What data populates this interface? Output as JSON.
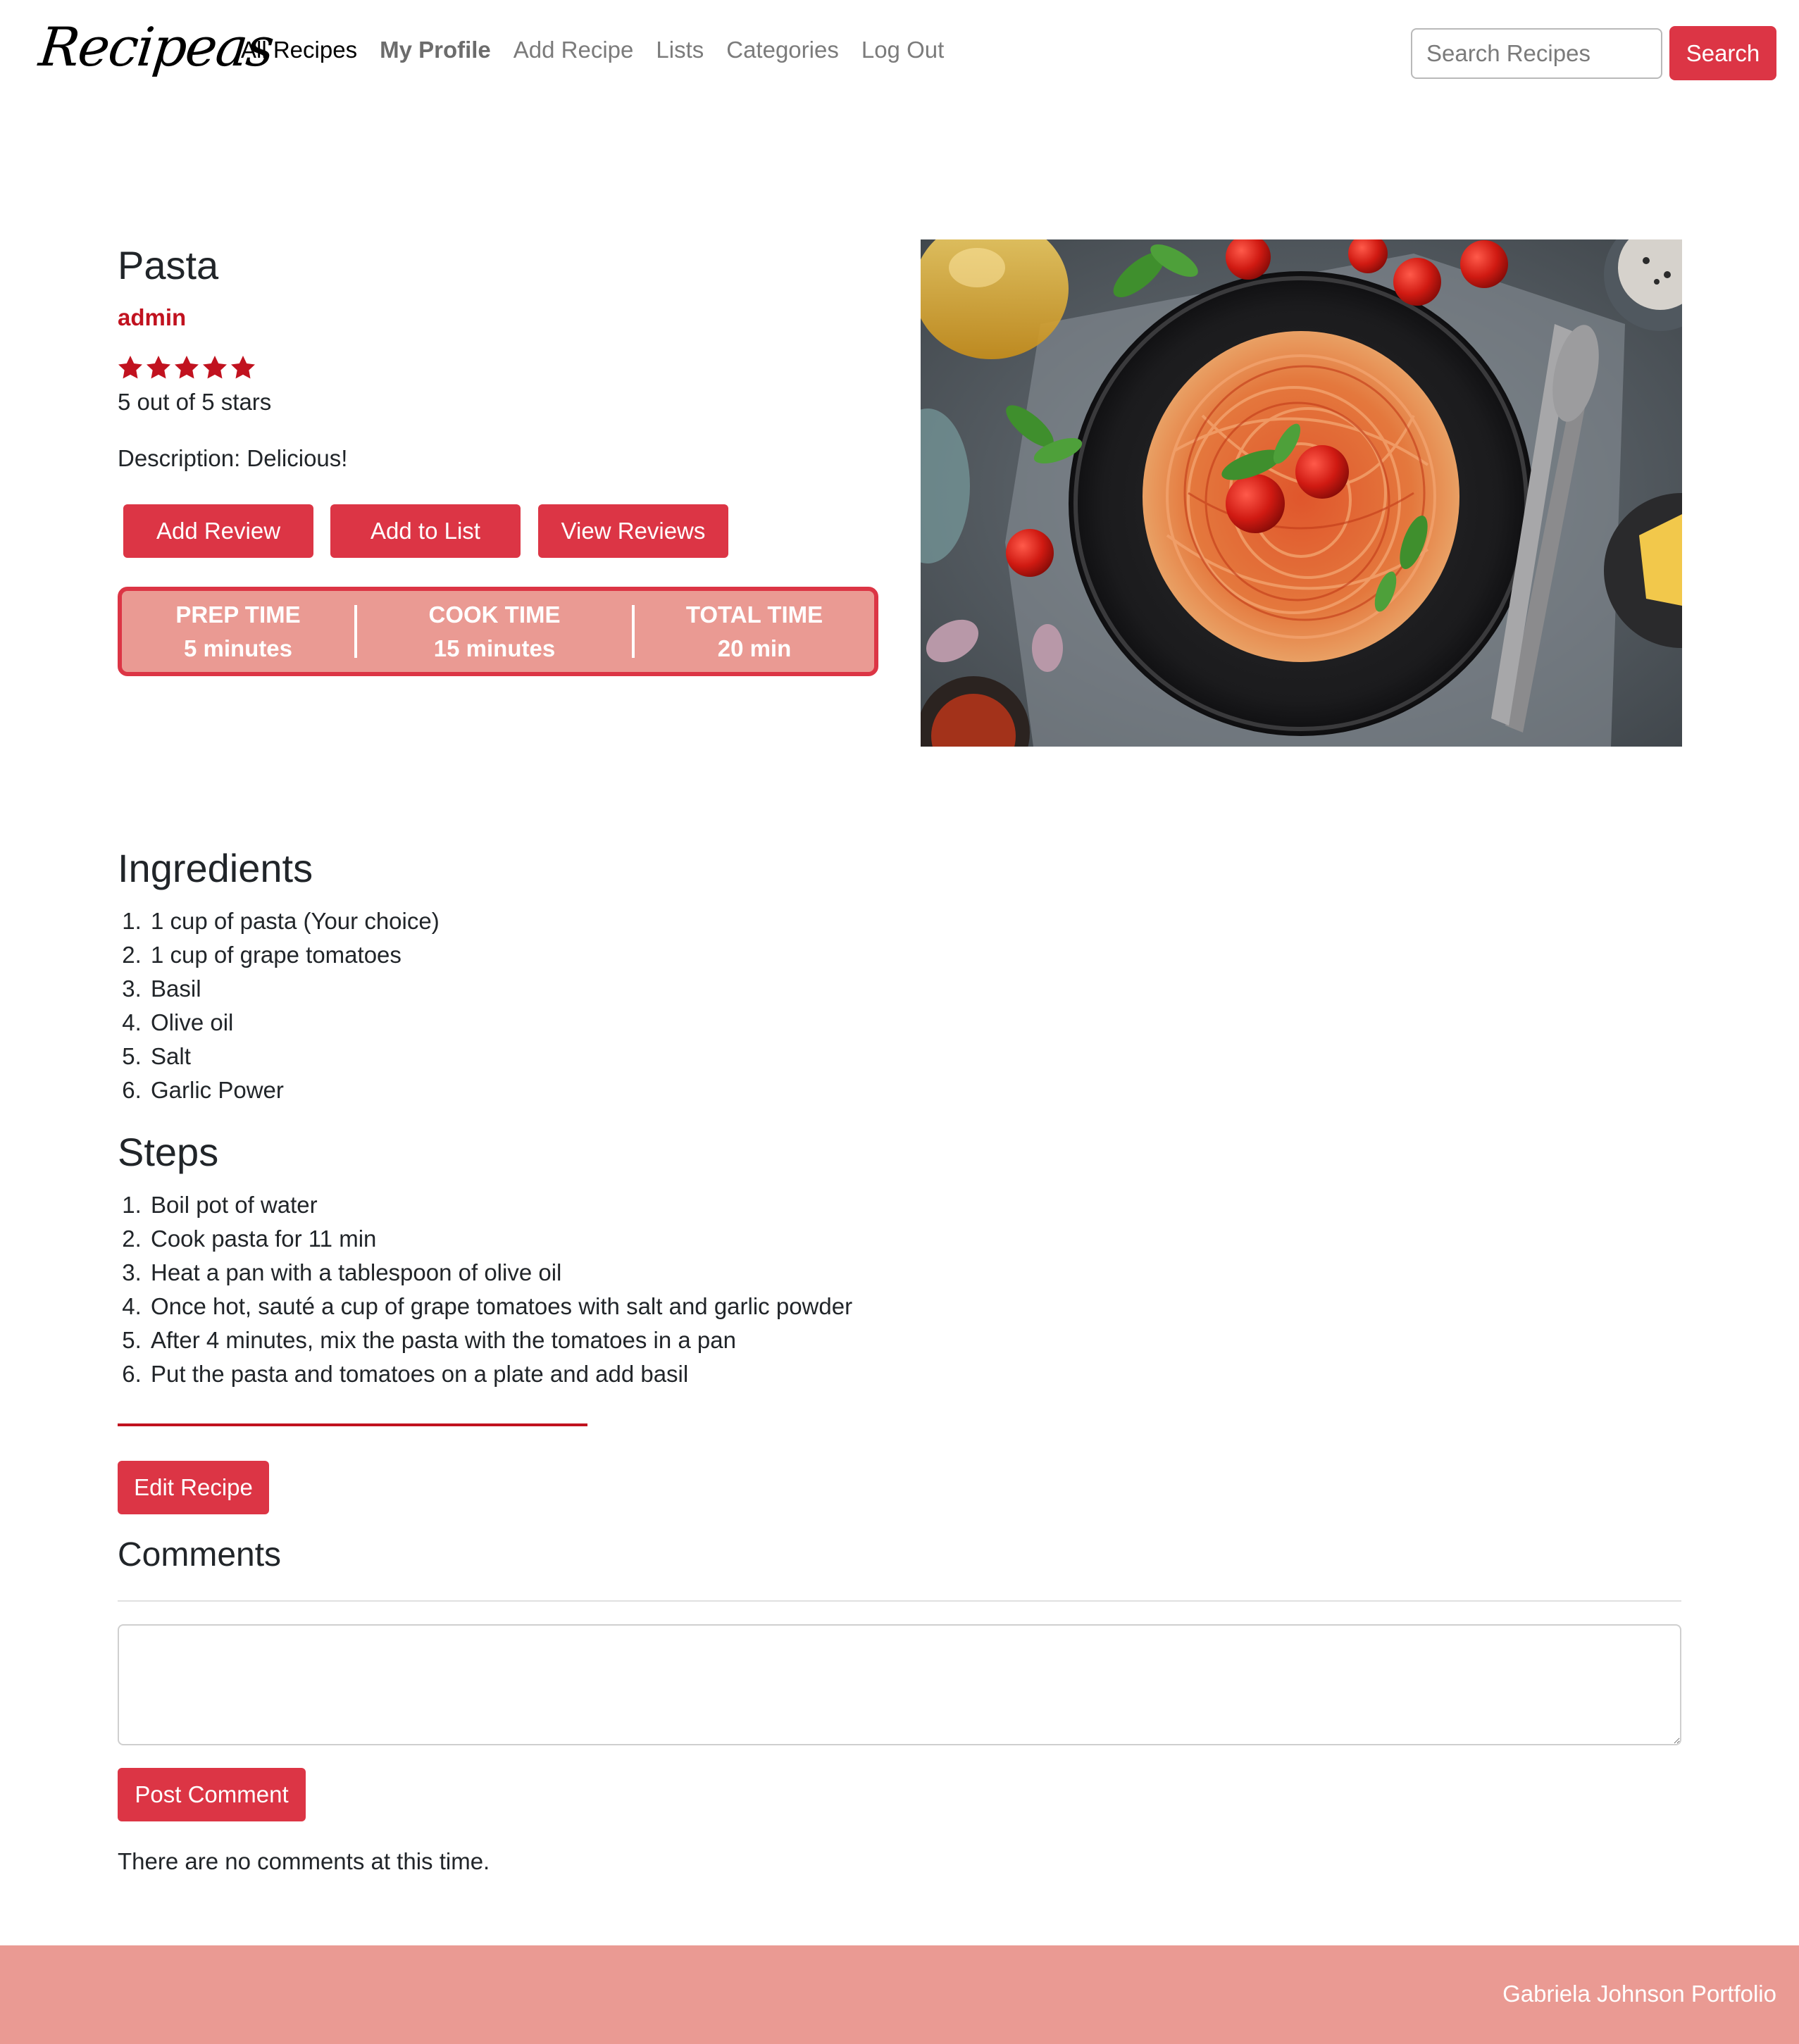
{
  "nav": {
    "logo": "Recipeas",
    "links": [
      "All Recipes",
      "My Profile",
      "Add Recipe",
      "Lists",
      "Categories",
      "Log Out"
    ],
    "search_placeholder": "Search Recipes",
    "search_button": "Search"
  },
  "recipe": {
    "title": "Pasta",
    "author": "admin",
    "rating": 5,
    "rating_max": 5,
    "rating_text": "5 out of 5 stars",
    "description": "Description: Delicious!",
    "buttons": [
      "Add Review",
      "Add to List",
      "View Reviews"
    ],
    "times": [
      {
        "label": "PREP TIME",
        "value": "5 minutes"
      },
      {
        "label": "COOK TIME",
        "value": "15 minutes"
      },
      {
        "label": "TOTAL TIME",
        "value": "20 min"
      }
    ]
  },
  "ingredients": {
    "heading": "Ingredients",
    "items": [
      "1 cup of pasta (Your choice)",
      "1 cup of grape tomatoes",
      "Basil",
      "Olive oil",
      "Salt",
      "Garlic Power"
    ]
  },
  "steps": {
    "heading": "Steps",
    "items": [
      "Boil pot of water",
      "Cook pasta for 11 min",
      "Heat a pan with a tablespoon of olive oil",
      "Once hot, sauté a cup of grape tomatoes with salt and garlic powder",
      "After 4 minutes, mix the pasta with the tomatoes in a pan",
      "Put the pasta and tomatoes on a plate and add basil"
    ]
  },
  "edit_button": "Edit Recipe",
  "comments": {
    "heading": "Comments",
    "post_button": "Post Comment",
    "empty_text": "There are no comments at this time."
  },
  "footer": {
    "text": "Gabriela Johnson Portfolio"
  },
  "colors": {
    "accent": "#dc3545",
    "author": "#c1121f",
    "time_box_bg": "#ea9a93",
    "footer_bg": "#ea9a93"
  },
  "icons": {
    "star": "star-icon"
  }
}
